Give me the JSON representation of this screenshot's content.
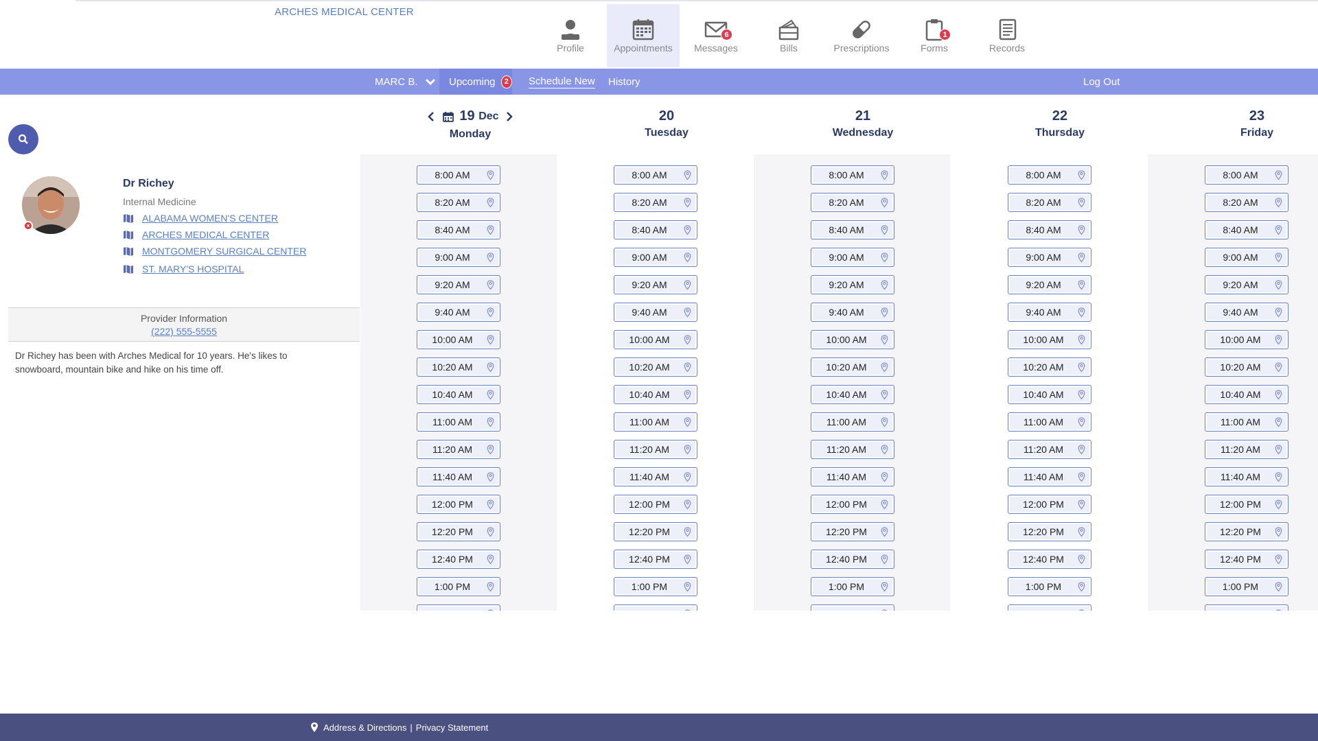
{
  "header": {
    "brand": "ARCHES MEDICAL CENTER",
    "nav": [
      {
        "label": "Profile",
        "icon": "profile-icon",
        "badge": ""
      },
      {
        "label": "Appointments",
        "icon": "calendar-icon",
        "badge": "",
        "active": true
      },
      {
        "label": "Messages",
        "icon": "envelope-icon",
        "badge": "6"
      },
      {
        "label": "Bills",
        "icon": "bills-icon",
        "badge": ""
      },
      {
        "label": "Prescriptions",
        "icon": "pill-icon",
        "badge": ""
      },
      {
        "label": "Forms",
        "icon": "clipboard-icon",
        "badge": "1"
      },
      {
        "label": "Records",
        "icon": "records-icon",
        "badge": ""
      }
    ]
  },
  "subnav": {
    "user": "MARC B.",
    "upcoming_label": "Upcoming",
    "upcoming_count": "2",
    "schedule_new": "Schedule New",
    "history": "History",
    "logout": "Log Out"
  },
  "provider": {
    "name": "Dr Richey",
    "specialty": "Internal Medicine",
    "locations": [
      "ALABAMA WOMEN'S CENTER",
      "ARCHES MEDICAL CENTER",
      "MONTGOMERY SURGICAL CENTER",
      "ST. MARY'S HOSPITAL"
    ],
    "info_label": "Provider Information",
    "phone": "(222) 555-5555",
    "bio": "Dr Richey has been with Arches Medical for 10 years. He's likes to snowboard, mountain bike and hike on his time off."
  },
  "calendar": {
    "month": "Dec",
    "days": [
      {
        "num": "19",
        "name": "Monday"
      },
      {
        "num": "20",
        "name": "Tuesday"
      },
      {
        "num": "21",
        "name": "Wednesday"
      },
      {
        "num": "22",
        "name": "Thursday"
      },
      {
        "num": "23",
        "name": "Friday"
      }
    ],
    "slots": [
      "8:00 AM",
      "8:20 AM",
      "8:40 AM",
      "9:00 AM",
      "9:20 AM",
      "9:40 AM",
      "10:00 AM",
      "10:20 AM",
      "10:40 AM",
      "11:00 AM",
      "11:20 AM",
      "11:40 AM",
      "12:00 PM",
      "12:20 PM",
      "12:40 PM",
      "1:00 PM"
    ]
  },
  "footer": {
    "address": "Address & Directions",
    "separator": "|",
    "privacy": "Privacy Statement"
  },
  "colors": {
    "subnav_bg": "#8996e6",
    "accent": "#5a7fc0",
    "badge": "#e03a4e",
    "footer_bg": "#4a5080"
  }
}
